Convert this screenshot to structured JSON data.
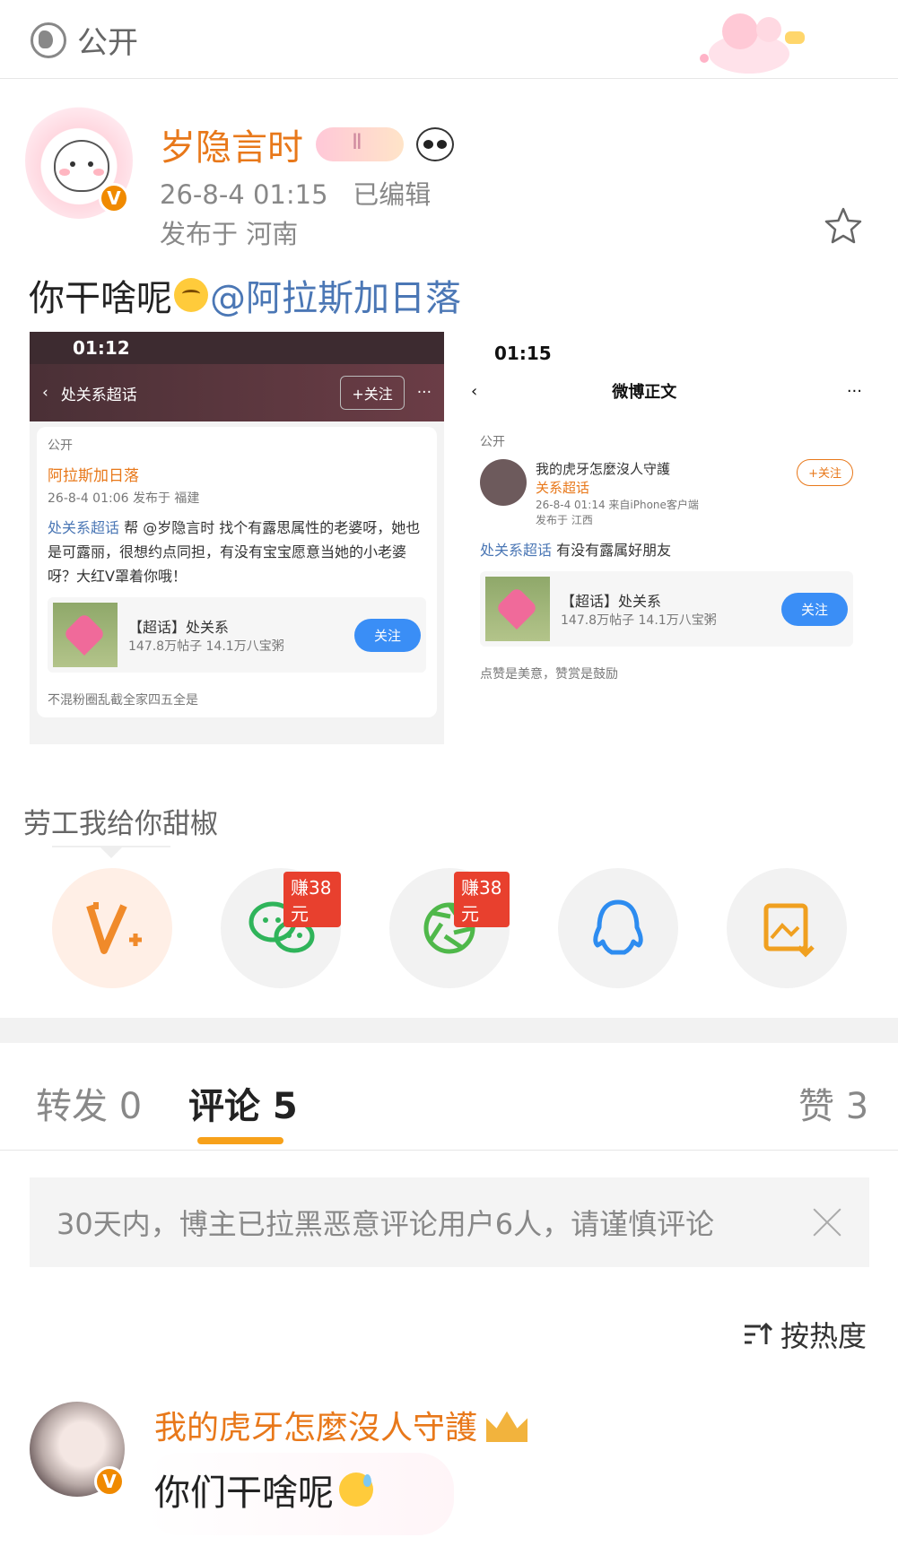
{
  "header": {
    "visibility_label": "公开"
  },
  "post": {
    "author": "岁隐言时",
    "time": "26-8-4 01:15",
    "edited": "已编辑",
    "location": "发布于 河南",
    "text": "你干啥呢",
    "mention": "@阿拉斯加日落"
  },
  "screenshot_left": {
    "status_time": "01:12",
    "nav_title": "处关系超话",
    "follow": "+关注",
    "visibility": "公开",
    "author": "阿拉斯加日落",
    "meta": "26-8-4 01:06  发布于 福建",
    "topic_tag": "处关系超话",
    "body": "帮 @岁隐言时 找个有露思属性的老婆呀，她也是可露丽，很想约点同担，有没有宝宝愿意当她的小老婆呀？大红V罩着你哦！",
    "topic_title": "【超话】处关系",
    "topic_stats": "147.8万帖子 14.1万八宝粥",
    "topic_btn": "关注",
    "footer": "不混粉圈乱截全家四五全是"
  },
  "screenshot_right": {
    "status_time": "01:15",
    "nav_title": "微博正文",
    "visibility": "公开",
    "author_line": "我的虎牙怎麼沒人守護",
    "author_sub": "关系超话",
    "follow": "+关注",
    "meta": "26-8-4 01:14  来自iPhone客户端",
    "meta2": "发布于 江西",
    "topic_tag": "处关系超话",
    "body": "有没有露属好朋友",
    "topic_title": "【超话】处关系",
    "topic_stats": "147.8万帖子 14.1万八宝粥",
    "topic_btn": "关注",
    "footer": "点赞是美意，赞赏是鼓励"
  },
  "share": {
    "title": "劳工我给你甜椒",
    "items": [
      {
        "icon": "weibo-v-plus-icon"
      },
      {
        "icon": "wechat-icon",
        "badge": "赚38元"
      },
      {
        "icon": "moments-icon",
        "badge": "赚38元"
      },
      {
        "icon": "qq-icon"
      },
      {
        "icon": "save-image-icon"
      }
    ]
  },
  "tabs": {
    "repost": "转发 0",
    "comment": "评论 5",
    "like": "赞 3"
  },
  "notice": "30天内，博主已拉黑恶意评论用户6人，请谨慎评论",
  "sort_label": "按热度",
  "comment": {
    "author": "我的虎牙怎麼沒人守護",
    "text": "你们干啥呢"
  },
  "colors": {
    "accent": "#e8781a",
    "link": "#4b77b5",
    "indicator": "#f7a11a",
    "earn": "#e8402e"
  }
}
